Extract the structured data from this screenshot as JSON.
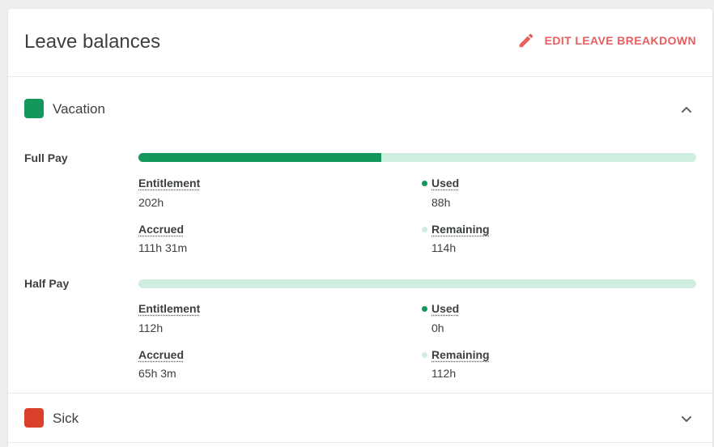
{
  "header": {
    "title": "Leave balances",
    "edit_label": "EDIT LEAVE BREAKDOWN"
  },
  "colors": {
    "accent": "#e85d5d",
    "vacation": "#14975a",
    "sick": "#d9412b",
    "used_dot": "#14975a",
    "remaining_dot": "#cfeee0"
  },
  "vacation": {
    "title": "Vacation",
    "expanded": true,
    "full_pay": {
      "label": "Full Pay",
      "used_fraction": 0.4356,
      "entitlement_label": "Entitlement",
      "entitlement": "202h",
      "accrued_label": "Accrued",
      "accrued": "111h 31m",
      "used_label": "Used",
      "used": "88h",
      "remaining_label": "Remaining",
      "remaining": "114h"
    },
    "half_pay": {
      "label": "Half Pay",
      "used_fraction": 0,
      "entitlement_label": "Entitlement",
      "entitlement": "112h",
      "accrued_label": "Accrued",
      "accrued": "65h 3m",
      "used_label": "Used",
      "used": "0h",
      "remaining_label": "Remaining",
      "remaining": "112h"
    }
  },
  "sick": {
    "title": "Sick",
    "expanded": false
  }
}
